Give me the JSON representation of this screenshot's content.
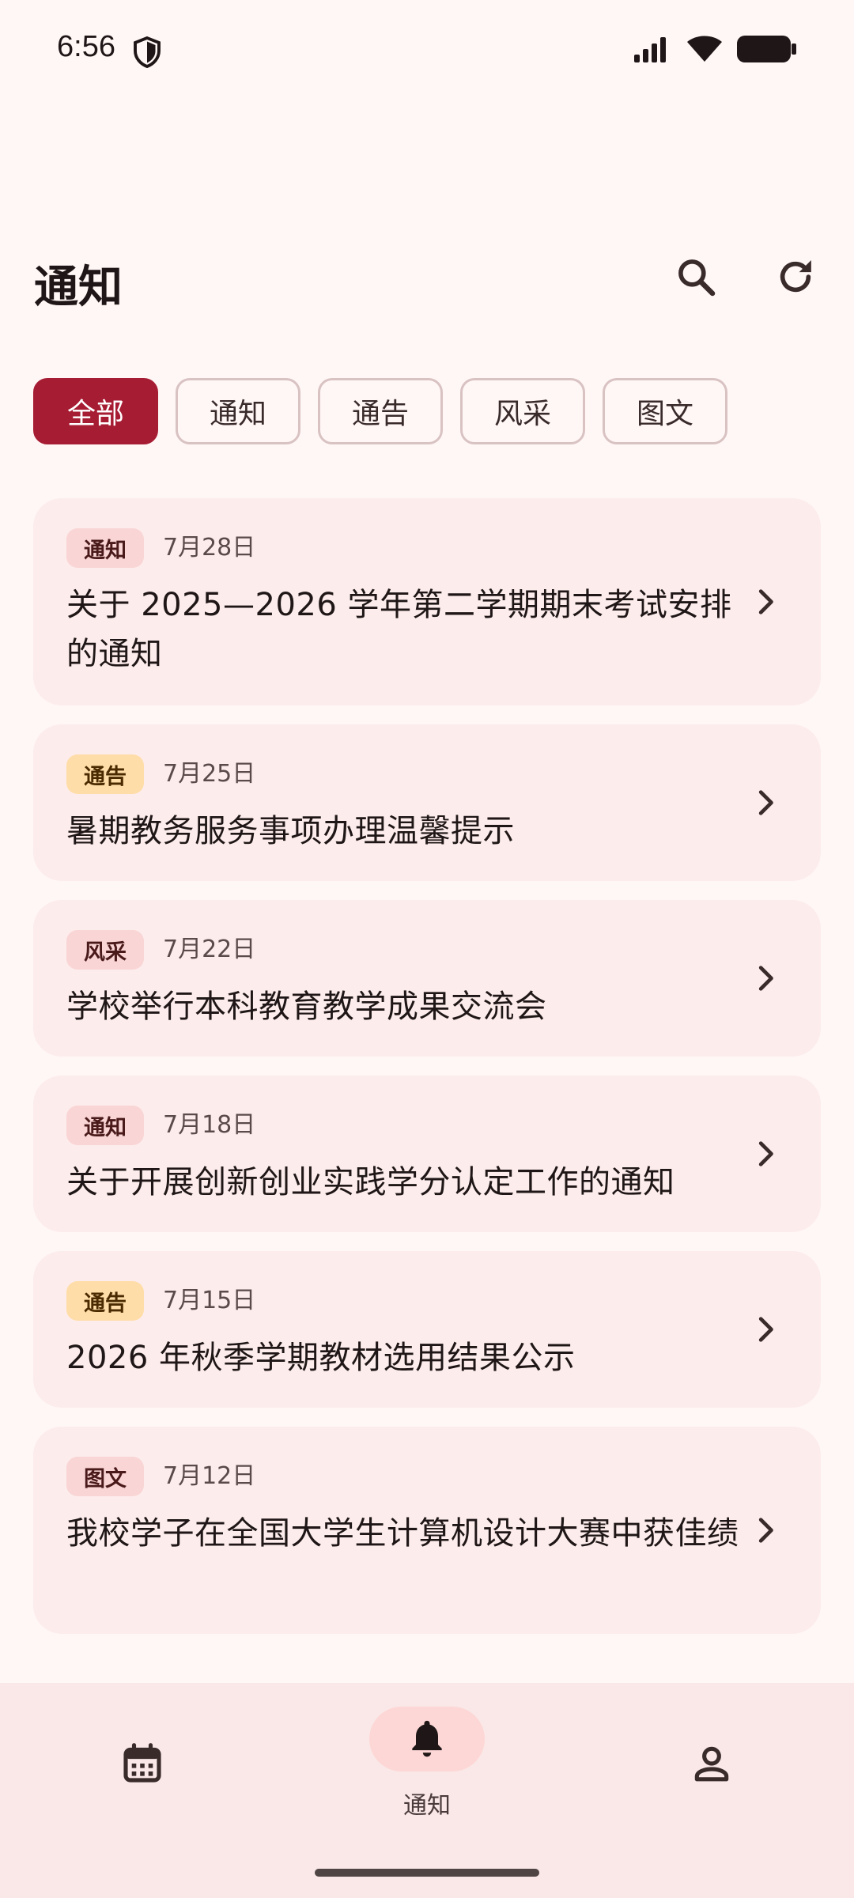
{
  "status_bar": {
    "time": "6:56",
    "icons": [
      "shield-icon",
      "signal-icon",
      "wifi-icon",
      "battery-icon"
    ]
  },
  "header": {
    "title": "通知",
    "icons": [
      "search-icon",
      "refresh-icon"
    ]
  },
  "filters": [
    {
      "label": "全部",
      "active": true
    },
    {
      "label": "通知",
      "active": false
    },
    {
      "label": "通告",
      "active": false
    },
    {
      "label": "风采",
      "active": false
    },
    {
      "label": "图文",
      "active": false
    }
  ],
  "notices": [
    {
      "tag": "通知",
      "date": "7月28日",
      "title": "关于 2025—2026 学年第二学期期末考试安排的通知",
      "tag_color": "#F9D5D5"
    },
    {
      "tag": "通告",
      "date": "7月25日",
      "title": "暑期教务服务事项办理温馨提示",
      "tag_color": "#FFDDA8"
    },
    {
      "tag": "风采",
      "date": "7月22日",
      "title": "学校举行本科教育教学成果交流会",
      "tag_color": "#F9D5D5"
    },
    {
      "tag": "通知",
      "date": "7月18日",
      "title": "关于开展创新创业实践学分认定工作的通知",
      "tag_color": "#F9D5D5"
    },
    {
      "tag": "通告",
      "date": "7月15日",
      "title": "2026 年秋季学期教材选用结果公示",
      "tag_color": "#FFDDA8"
    },
    {
      "tag": "图文",
      "date": "7月12日",
      "title": "我校学子在全国大学生计算机设计大赛中获佳绩",
      "tag_color": "#F9D5D5"
    }
  ],
  "bottom_nav": {
    "items": [
      {
        "icon": "calendar-icon",
        "label": ""
      },
      {
        "icon": "bell-icon",
        "label": "通知",
        "active": true
      },
      {
        "icon": "person-icon",
        "label": ""
      }
    ]
  },
  "colors": {
    "accent": "#A61C33",
    "background": "#FFF7F6",
    "card": "#FDECEC",
    "nav_bg": "#F9E8E7",
    "active_pill": "#FDD7D6"
  }
}
